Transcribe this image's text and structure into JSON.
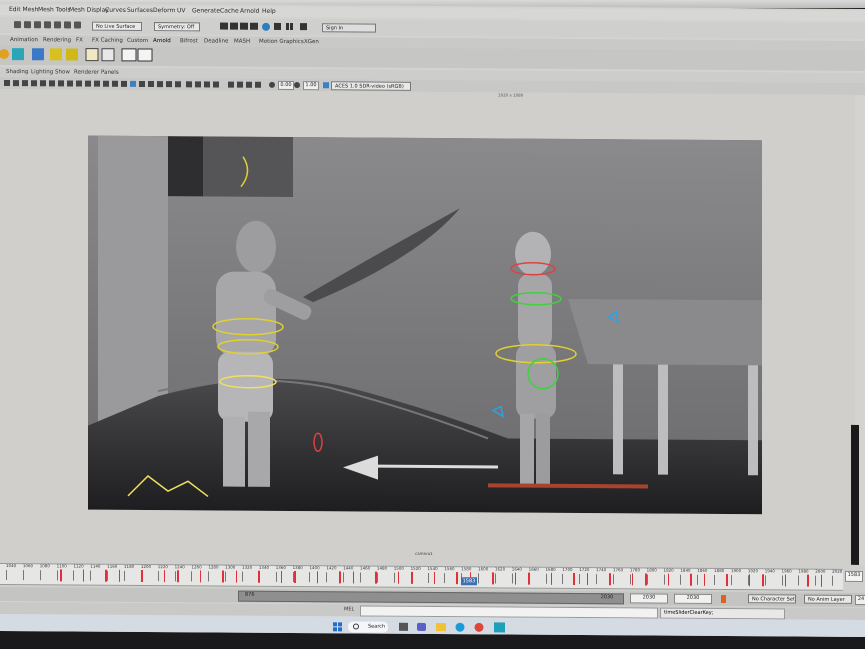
{
  "app": {
    "title": ""
  },
  "menu": [
    "Edit Mesh",
    "Mesh Tools",
    "Mesh Display",
    "Curves",
    "Surfaces",
    "Deform",
    "UV",
    "Generate",
    "Cache",
    "Arnold",
    "Help"
  ],
  "status_line": {
    "live_surface": "No Live Surface",
    "symmetry": "Symmetry: Off",
    "sign_in": "Sign In"
  },
  "shelf_tabs": [
    "Animation",
    "Rendering",
    "FX",
    "FX Caching",
    "Custom",
    "Arnold",
    "Bifrost",
    "Deadline",
    "MASH",
    "Motion Graphics",
    "XGen"
  ],
  "panel_menu": [
    "Shading",
    "Lighting",
    "Show",
    "Renderer",
    "Panels"
  ],
  "panel_tools": {
    "exposure": "0.00",
    "gamma": "1.00",
    "color_space": "ACES 1.0 SDR-video (sRGB)"
  },
  "viewport": {
    "resolution": "1920 x 1080",
    "camera": "camera1"
  },
  "timeline": {
    "ticks": [
      "1040",
      "1060",
      "1080",
      "1100",
      "1120",
      "1140",
      "1160",
      "1180",
      "1200",
      "1220",
      "1240",
      "1260",
      "1280",
      "1300",
      "1320",
      "1340",
      "1360",
      "1380",
      "1400",
      "1420",
      "1440",
      "1460",
      "1480",
      "1500",
      "1520",
      "1540",
      "1560",
      "1580",
      "1600",
      "1620",
      "1640",
      "1660",
      "1680",
      "1700",
      "1720",
      "1740",
      "1760",
      "1780",
      "1800",
      "1820",
      "1840",
      "1860",
      "1880",
      "1900",
      "1920",
      "1940",
      "1960",
      "1980",
      "2000",
      "2020"
    ],
    "current_frame": "1583",
    "current_frame_field": "1583"
  },
  "range_slider": {
    "start": "876",
    "end": "2030",
    "range_end_1": "2030",
    "range_end_2": "2030",
    "character_set": "No Character Set",
    "anim_layer": "No Anim Layer",
    "fps": "24"
  },
  "command_line": {
    "language": "MEL",
    "result": "timeSliderClearKey;"
  },
  "taskbar": {
    "search_label": "Search"
  },
  "colors": {
    "key_tick": "#e0303a",
    "timeline_bg": "#cfcfce",
    "viewport_bg": "#6b6b6d",
    "taskbar_bg": "#d5dbe3"
  }
}
